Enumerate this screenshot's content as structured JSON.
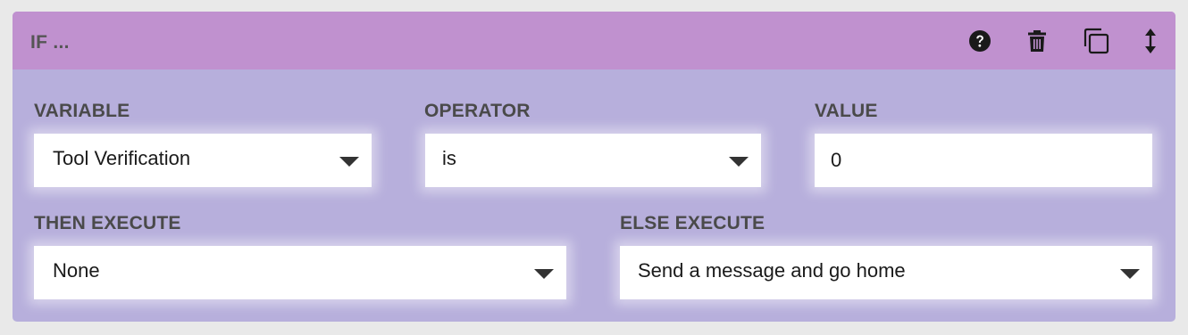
{
  "header": {
    "title": "IF ...",
    "icons": [
      "help-icon",
      "trash-icon",
      "duplicate-icon",
      "move-icon"
    ]
  },
  "variable": {
    "label": "VARIABLE",
    "selected": "Tool Verification"
  },
  "operator": {
    "label": "OPERATOR",
    "selected": "is"
  },
  "value": {
    "label": "VALUE",
    "current": "0"
  },
  "then_execute": {
    "label": "THEN EXECUTE",
    "selected": "None"
  },
  "else_execute": {
    "label": "ELSE EXECUTE",
    "selected": "Send a message and go home"
  },
  "colors": {
    "header_bg": "#c091cf",
    "body_bg": "#b7afdc",
    "page_bg": "#e9e9e9"
  }
}
